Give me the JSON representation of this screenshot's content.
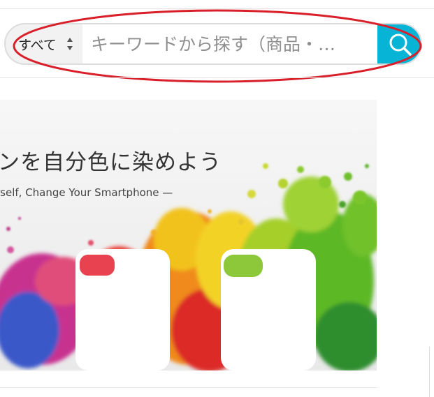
{
  "search": {
    "category_label": "すべて",
    "placeholder": "キーワードから探す（商品・…",
    "button_icon": "search-icon",
    "accent_color": "#08b4d6"
  },
  "annotation": {
    "shape": "ellipse",
    "color": "#d81f2a"
  },
  "banner": {
    "title": "ンを自分色に染めよう",
    "subtitle": "rself,  Change Your Smartphone —"
  }
}
